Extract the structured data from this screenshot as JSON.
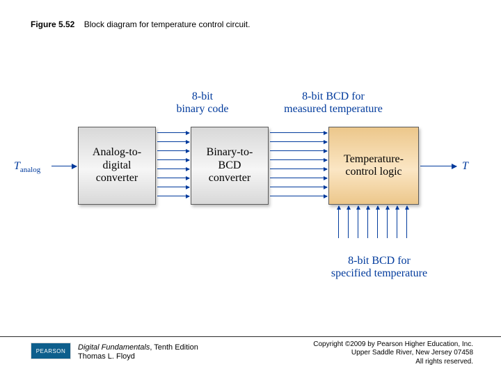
{
  "caption": {
    "fignum": "Figure 5.52",
    "text": "Block diagram for temperature control circuit."
  },
  "diagram": {
    "input_label_html": "T<sub>analog</sub>",
    "output_label": "T",
    "blocks": {
      "adc": "Analog-to-\ndigital\nconverter",
      "b2bcd": "Binary-to-\nBCD\nconverter",
      "tcl": "Temperature-\ncontrol logic"
    },
    "bus_labels": {
      "top1": "8-bit\nbinary code",
      "top2": "8-bit BCD for\nmeasured temperature",
      "bottom": "8-bit BCD for\nspecified temperature"
    },
    "bus_width": 8
  },
  "footer": {
    "publisher_badge": "PEARSON",
    "book_title": "Digital Fundamentals",
    "book_edition": ", Tenth Edition",
    "author": "Thomas L. Floyd",
    "copyright_line1": "Copyright ©2009 by Pearson Higher Education, Inc.",
    "copyright_line2": "Upper Saddle River, New Jersey 07458",
    "copyright_line3": "All rights reserved."
  }
}
